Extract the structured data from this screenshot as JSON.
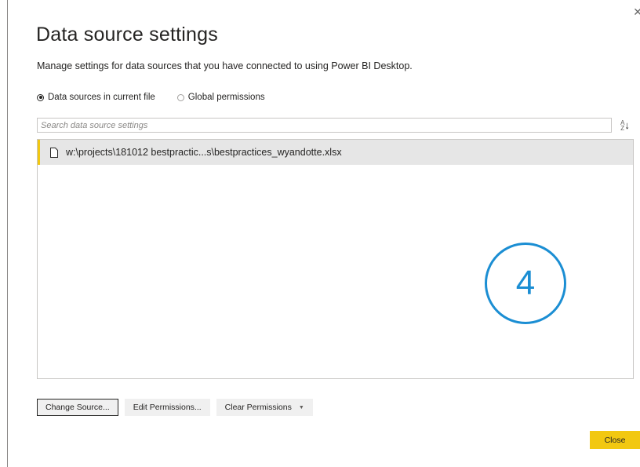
{
  "dialog": {
    "title": "Data source settings",
    "subtitle": "Manage settings for data sources that you have connected to using Power BI Desktop.",
    "close_glyph": "✕"
  },
  "scope": {
    "options": [
      {
        "label": "Data sources in current file",
        "checked": true
      },
      {
        "label": "Global permissions",
        "checked": false
      }
    ]
  },
  "search": {
    "placeholder": "Search data source settings",
    "value": ""
  },
  "sort": {
    "icon": "sort-az-icon",
    "top": "A",
    "bottom": "Z",
    "arrow": "↓"
  },
  "sources": [
    {
      "icon": "file-icon",
      "path": "w:\\projects\\181012 bestpractic...s\\bestpractices_wyandotte.xlsx",
      "selected": true
    }
  ],
  "annotation": {
    "label": "4",
    "color": "#1b8ed3"
  },
  "actions": {
    "change_source": "Change Source...",
    "edit_permissions": "Edit Permissions...",
    "clear_permissions": "Clear Permissions",
    "close": "Close"
  },
  "colors": {
    "accent": "#f2c811",
    "selected_row": "#e6e6e6",
    "annotation": "#1b8ed3"
  }
}
